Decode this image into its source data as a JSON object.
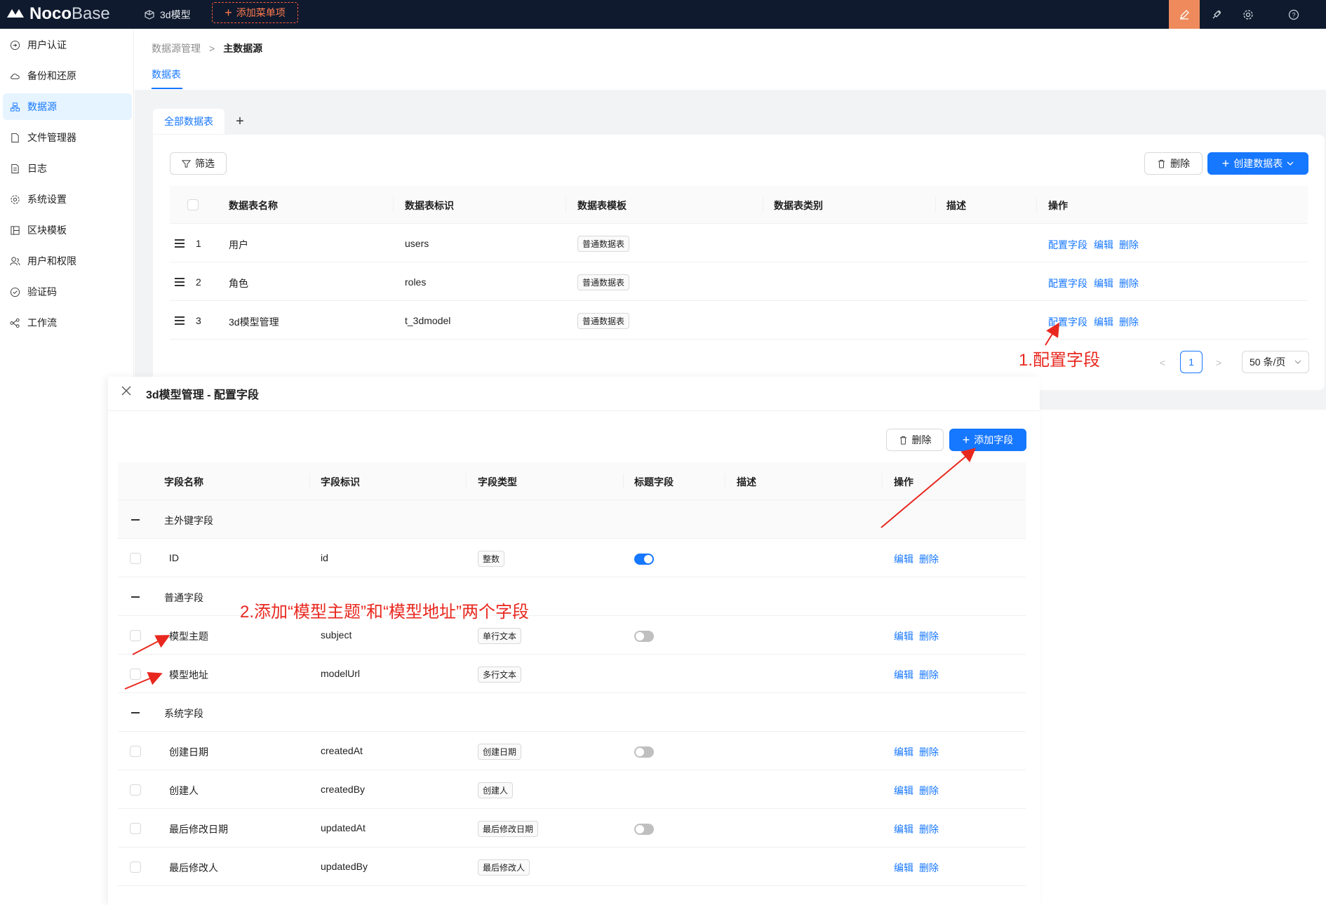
{
  "topbar": {
    "logo_noco": "Noco",
    "logo_base": "Base",
    "nav_item": "3d模型",
    "add_menu": "添加菜单项",
    "icons": [
      "pencil-icon",
      "plugin-icon",
      "gear-icon",
      "help-icon"
    ],
    "accent_color": "#ee8a5c"
  },
  "sidebar": {
    "items": [
      {
        "label": "用户认证",
        "icon": "login-icon"
      },
      {
        "label": "备份和还原",
        "icon": "cloud-icon"
      },
      {
        "label": "数据源",
        "icon": "database-icon",
        "active": true
      },
      {
        "label": "文件管理器",
        "icon": "file-icon"
      },
      {
        "label": "日志",
        "icon": "log-icon"
      },
      {
        "label": "系统设置",
        "icon": "settings-icon"
      },
      {
        "label": "区块模板",
        "icon": "block-icon"
      },
      {
        "label": "用户和权限",
        "icon": "users-icon"
      },
      {
        "label": "验证码",
        "icon": "check-circle-icon"
      },
      {
        "label": "工作流",
        "icon": "workflow-icon"
      }
    ]
  },
  "breadcrumb": {
    "parent": "数据源管理",
    "current": "主数据源"
  },
  "page_tab": "数据表",
  "subtabs": {
    "all": "全部数据表",
    "add": "+"
  },
  "toolbar": {
    "filter": "筛选",
    "delete": "删除",
    "create": "创建数据表"
  },
  "collections_table": {
    "headers": [
      "数据表名称",
      "数据表标识",
      "数据表模板",
      "数据表类别",
      "描述",
      "操作"
    ],
    "rows": [
      {
        "index": "1",
        "name": "用户",
        "key": "users",
        "template": "普通数据表"
      },
      {
        "index": "2",
        "name": "角色",
        "key": "roles",
        "template": "普通数据表"
      },
      {
        "index": "3",
        "name": "3d模型管理",
        "key": "t_3dmodel",
        "template": "普通数据表"
      }
    ],
    "actions": {
      "configure": "配置字段",
      "edit": "编辑",
      "delete": "删除"
    }
  },
  "pagination": {
    "prev": "<",
    "current": "1",
    "next": ">",
    "page_size": "50 条/页"
  },
  "drawer": {
    "title": "3d模型管理 - 配置字段",
    "delete": "删除",
    "add_field": "添加字段",
    "headers": [
      "字段名称",
      "字段标识",
      "字段类型",
      "标题字段",
      "描述",
      "操作"
    ],
    "groups": [
      {
        "label": "主外键字段",
        "fields": [
          {
            "name": "ID",
            "key": "id",
            "type": "整数",
            "toggle": "on"
          }
        ]
      },
      {
        "label": "普通字段",
        "fields": [
          {
            "name": "模型主题",
            "key": "subject",
            "type": "单行文本",
            "toggle": "off"
          },
          {
            "name": "模型地址",
            "key": "modelUrl",
            "type": "多行文本",
            "toggle": "none"
          }
        ]
      },
      {
        "label": "系统字段",
        "fields": [
          {
            "name": "创建日期",
            "key": "createdAt",
            "type": "创建日期",
            "toggle": "off"
          },
          {
            "name": "创建人",
            "key": "createdBy",
            "type": "创建人",
            "toggle": "none"
          },
          {
            "name": "最后修改日期",
            "key": "updatedAt",
            "type": "最后修改日期",
            "toggle": "off"
          },
          {
            "name": "最后修改人",
            "key": "updatedBy",
            "type": "最后修改人",
            "toggle": "none"
          }
        ]
      }
    ],
    "actions": {
      "edit": "编辑",
      "delete": "删除"
    }
  },
  "annotations": {
    "step1": "1.配置字段",
    "step2": "2.添加“模型主题”和“模型地址”两个字段",
    "color": "#e8281f"
  }
}
